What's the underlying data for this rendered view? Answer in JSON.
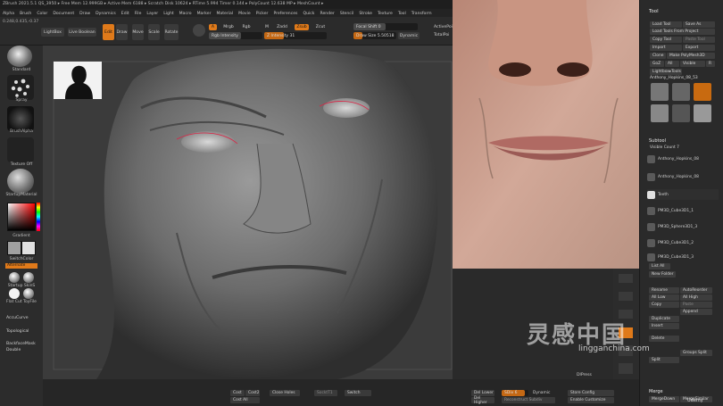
{
  "titlebar": {
    "info": "ZBrush 2021.5.1   QS_3950   ▸ Free Mem 12.999GB ▸ Active Mem 6188 ▸ Scratch Disk 10624 ▸ RTime 5.994 Timer 0.144 ▸ PolyCount 12.638 MP ▸ MeshCount ▸"
  },
  "menus": [
    "Alpha",
    "Brush",
    "Color",
    "Document",
    "Draw",
    "Dynamics",
    "Edit",
    "File",
    "Layer",
    "Light",
    "Macro",
    "Marker",
    "Material",
    "Movie",
    "Picker",
    "Preferences",
    "Quick",
    "Render",
    "Stencil",
    "Stroke",
    "Texture",
    "Tool",
    "Transform"
  ],
  "coords": "0.248,0.435,-0.37",
  "toolbar": {
    "lightbox": "LightBox",
    "live_boolean": "Live Boolean",
    "edit": "Edit",
    "draw": "Draw",
    "move": "Move",
    "scale": "Scale",
    "rotate": "Rotate",
    "a_label": "A",
    "mrgb": "Mrgb",
    "rgb": "Rgb",
    "m": "M",
    "zadd": "Zadd",
    "zsub": "Zsub",
    "zcut": "Zcut",
    "z_intensity": "Z Intensity 31",
    "rgb_intensity": "Rgb Intensity",
    "focal_shift": "Focal Shift 0",
    "draw_size": "Draw Size 5.50518",
    "dynamic": "Dynamic",
    "active_points": "ActivePoi",
    "total_points": "TotalPoi"
  },
  "leftshelf": {
    "standard": "Standard",
    "spray": "Spray",
    "brush_alpha": "BrushAlpha",
    "texture_off": "Texture Off",
    "startup_material": "StartupMaterial",
    "gradient": "Gradient",
    "switch_color": "SwitchColor",
    "alternate": "Alternate",
    "startup_skin": "Startup SkinS",
    "flat_cut": "Flat Cut ToyFile",
    "accucurve": "AccuCurve",
    "topological": "Topological",
    "backface_mask": "BackfaceMask",
    "double": "Double"
  },
  "tray": {
    "title": "Tool",
    "load_tool": "Load Tool",
    "save_as": "Save As",
    "load_from_project": "Load Tools From Project",
    "copy_tool": "Copy Tool",
    "paste_tool": "Paste Tool",
    "import": "Import",
    "export": "Export",
    "clone": "Clone",
    "make_polymesh": "Make PolyMesh3D",
    "goz": "GoZ",
    "all": "All",
    "visible": "Visible",
    "r": "R",
    "lightbox_tools": "Lightbox▸Tools",
    "current_tool": "Anthony_Hopkins_08_53",
    "subtool_title": "Subtool",
    "visible_count": "Visible Count 7",
    "subtools": [
      "Anthony_Hopkins_08",
      "Anthony_Hopkins_08",
      "Teeth",
      "PM3D_Cube3D1_1",
      "PM3D_Sphere3D1_3",
      "PM3D_Cube3D1_2",
      "PM3D_Cube3D1_3"
    ],
    "list_all": "List All",
    "new_folder": "New Folder",
    "rename": "Rename",
    "autoreorder": "AutoReorder",
    "all_low": "All Low",
    "all_high": "All High",
    "copy": "Copy",
    "paste": "Paste",
    "append": "Append",
    "duplicate": "Duplicate",
    "insert": "Insert",
    "delete": "Delete",
    "groups_split": "Groups Split",
    "split": "Split",
    "merge_title": "Merge",
    "merge_down": "MergeDown",
    "merge_similar": "MergeSimilar"
  },
  "bottombar": {
    "cost": "Cost",
    "cost2": "Cost2",
    "cost_all": "Cost All",
    "close_holes": "Close Holes",
    "sockt": "SocktT1",
    "switch": "Switch",
    "del_lower": "Del Lower",
    "sdiv": "SDiv 6",
    "dynamic": "Dynamic",
    "del_higher": "Del Higher",
    "reconstruct": "Reconstruct Subdiv",
    "store_config": "Store Config",
    "enable_customize": "Enable Customize",
    "dlpress": "DlPress"
  },
  "watermark": {
    "text": "灵感中国",
    "url": "lingganchina.com",
    "udemy": "Udemy"
  }
}
